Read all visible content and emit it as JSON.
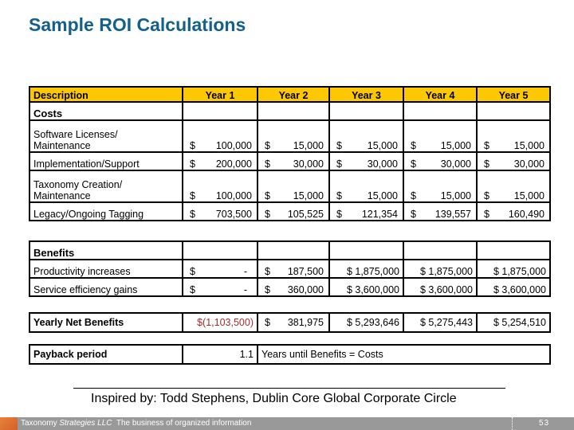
{
  "title": "Sample ROI Calculations",
  "header": {
    "description": "Description",
    "years": [
      "Year 1",
      "Year 2",
      "Year 3",
      "Year 4",
      "Year 5"
    ]
  },
  "costs": {
    "section_label": "Costs",
    "rows": [
      {
        "label_line1": "Software Licenses/",
        "label_line2": "Maintenance",
        "values": [
          "100,000",
          "15,000",
          "15,000",
          "15,000",
          "15,000"
        ]
      },
      {
        "label_line1": "",
        "label_line2": "Implementation/Support",
        "values": [
          "200,000",
          "30,000",
          "30,000",
          "30,000",
          "30,000"
        ]
      },
      {
        "label_line1": "Taxonomy Creation/",
        "label_line2": "Maintenance",
        "values": [
          "100,000",
          "15,000",
          "15,000",
          "15,000",
          "15,000"
        ]
      },
      {
        "label_line1": "",
        "label_line2": "Legacy/Ongoing Tagging",
        "values": [
          "703,500",
          "105,525",
          "121,354",
          "139,557",
          "160,490"
        ]
      }
    ]
  },
  "benefits": {
    "section_label": "Benefits",
    "rows": [
      {
        "label": "Productivity increases",
        "values": [
          "-",
          "187,500",
          "$ 1,875,000",
          "$ 1,875,000",
          "$ 1,875,000"
        ]
      },
      {
        "label": "Service efficiency gains",
        "values": [
          "-",
          "360,000",
          "$ 3,600,000",
          "$ 3,600,000",
          "$ 3,600,000"
        ]
      }
    ]
  },
  "net": {
    "label": "Yearly Net Benefits",
    "values": [
      "$(1,103,500)",
      "381,975",
      "$ 5,293,646",
      "$ 5,275,443",
      "$ 5,254,510"
    ],
    "negative_color": "#a52a2a"
  },
  "payback": {
    "label": "Payback period",
    "value": "1.1",
    "note": "Years until Benefits = Costs"
  },
  "currency": "$",
  "credit": "Inspired by: Todd Stephens, Dublin Core Global Corporate Circle",
  "footer": {
    "company_plain": "Taxonomy ",
    "company_italic": "Strategies LLC",
    "tagline": "  The business of organized information",
    "page_number": "53"
  },
  "colors": {
    "title": "#14608c",
    "header_bg": "#fdc800",
    "footer_bg": "#999999"
  }
}
